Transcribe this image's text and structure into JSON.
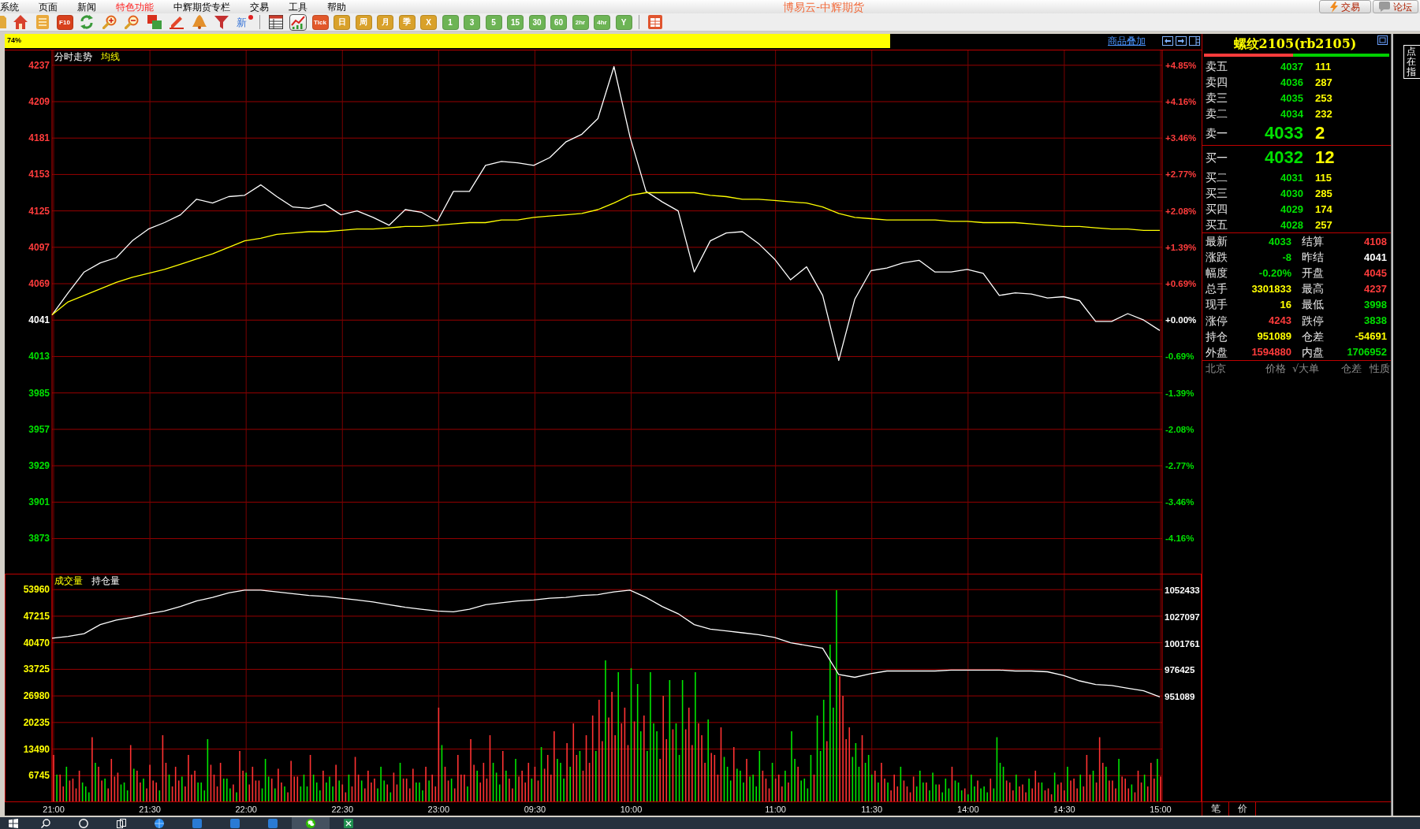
{
  "menu_bar": {
    "items": [
      {
        "label": "系统",
        "highlighted": false
      },
      {
        "label": "页面",
        "highlighted": false
      },
      {
        "label": "新闻",
        "highlighted": false
      },
      {
        "label": "特色功能",
        "highlighted": true
      },
      {
        "label": "中辉期货专栏",
        "highlighted": false
      },
      {
        "label": "交易",
        "highlighted": false
      },
      {
        "label": "工具",
        "highlighted": false
      },
      {
        "label": "帮助",
        "highlighted": false
      }
    ],
    "title": "博易云-中辉期货",
    "buttons": [
      {
        "label": "交易"
      },
      {
        "label": "论坛"
      }
    ]
  },
  "toolbar": {
    "items": [
      {
        "kind": "icon",
        "selected": false
      },
      {
        "kind": "icon",
        "selected": false
      },
      {
        "kind": "icon",
        "selected": false
      },
      {
        "kind": "text",
        "label": "F10",
        "color": "#d8401c",
        "selected": false
      },
      {
        "kind": "icon",
        "selected": false
      },
      {
        "kind": "icon",
        "selected": false
      },
      {
        "kind": "icon",
        "selected": false
      },
      {
        "kind": "icon",
        "selected": false
      },
      {
        "kind": "icon",
        "selected": false
      },
      {
        "kind": "icon",
        "selected": false
      },
      {
        "kind": "icon",
        "selected": false
      },
      {
        "kind": "dotted",
        "label": "新",
        "selected": false
      },
      {
        "kind": "separator"
      },
      {
        "kind": "icon",
        "selected": false
      },
      {
        "kind": "icon",
        "selected": true
      },
      {
        "kind": "text",
        "label": "Tick",
        "color": "#e2582a",
        "selected": false
      },
      {
        "kind": "text",
        "label": "日",
        "color": "#d9a12a",
        "selected": false
      },
      {
        "kind": "text",
        "label": "周",
        "color": "#d9a12a",
        "selected": false
      },
      {
        "kind": "text",
        "label": "月",
        "color": "#d9a12a",
        "selected": false
      },
      {
        "kind": "text",
        "label": "季",
        "color": "#d9a12a",
        "selected": false
      },
      {
        "kind": "text",
        "label": "X",
        "color": "#d9a12a",
        "selected": false
      },
      {
        "kind": "text",
        "label": "1",
        "color": "#6db455",
        "selected": false
      },
      {
        "kind": "text",
        "label": "3",
        "color": "#6db455",
        "selected": false
      },
      {
        "kind": "text",
        "label": "5",
        "color": "#6db455",
        "selected": false
      },
      {
        "kind": "text",
        "label": "15",
        "color": "#6db455",
        "selected": false
      },
      {
        "kind": "text",
        "label": "30",
        "color": "#6db455",
        "selected": false
      },
      {
        "kind": "text",
        "label": "60",
        "color": "#6db455",
        "selected": false
      },
      {
        "kind": "text",
        "label": "2hr",
        "color": "#6db455",
        "selected": false
      },
      {
        "kind": "text",
        "label": "4hr",
        "color": "#6db455",
        "selected": false
      },
      {
        "kind": "text",
        "label": "Y",
        "color": "#6db455",
        "selected": false
      },
      {
        "kind": "separator"
      },
      {
        "kind": "icon",
        "selected": false
      }
    ]
  },
  "progress_bar": {
    "label": "74%",
    "level": 0.74,
    "link": "商品叠加"
  },
  "price_panel": {
    "chart_data": {
      "type": "line",
      "grid": true,
      "categories": [
        null,
        null,
        null,
        null,
        null,
        null,
        null,
        null,
        null,
        null,
        null,
        null,
        null,
        null,
        null,
        null,
        null,
        null,
        null,
        null,
        null,
        null,
        null,
        null,
        null,
        null,
        null,
        null,
        null,
        null,
        null,
        null,
        null,
        null,
        null,
        null,
        null,
        null,
        null,
        null,
        null,
        null,
        null,
        null,
        null,
        null,
        null,
        null,
        null,
        null,
        null,
        null,
        null,
        null,
        null,
        null,
        null,
        null,
        null,
        null,
        null,
        null,
        null,
        null,
        null,
        null,
        null,
        null,
        null,
        null
      ],
      "ylim": [
        3846,
        4249
      ],
      "yticks": [
        4237,
        4209,
        4181,
        4153,
        4125,
        4097,
        4069,
        4041,
        4013,
        3985,
        3957,
        3929,
        3901,
        3873
      ],
      "series": [
        {
          "name": "分时走势",
          "color": "#ffffff",
          "values": [
            4045,
            4062,
            4078,
            4085,
            4089,
            4102,
            4111,
            4116,
            4122,
            4134,
            4131,
            4136,
            4137,
            4145,
            4136,
            4128,
            4127,
            4130,
            4122,
            4125,
            4120,
            4114,
            4126,
            4124,
            4117,
            4140,
            4140,
            4160,
            4163,
            4162,
            4160,
            4166,
            4178,
            4184,
            4196,
            4236,
            4182,
            4140,
            4132,
            4125,
            4078,
            4102,
            4108,
            4109,
            4100,
            4088,
            4072,
            4082,
            4060,
            4010,
            4057,
            4079,
            4081,
            4085,
            4087,
            4078,
            4078,
            4080,
            4077,
            4060,
            4062,
            4061,
            4058,
            4059,
            4056,
            4040,
            4040,
            4046,
            4041,
            4033
          ]
        },
        {
          "name": "均线",
          "color": "#ffff00",
          "values": [
            4045,
            4055,
            4060,
            4065,
            4070,
            4074,
            4077,
            4080,
            4084,
            4088,
            4092,
            4097,
            4102,
            4104,
            4107,
            4108,
            4109,
            4109,
            4110,
            4111,
            4111,
            4112,
            4113,
            4113,
            4114,
            4115,
            4116,
            4116,
            4118,
            4118,
            4120,
            4121,
            4122,
            4123,
            4126,
            4131,
            4137,
            4139,
            4139,
            4139,
            4139,
            4137,
            4136,
            4134,
            4134,
            4133,
            4132,
            4131,
            4128,
            4123,
            4120,
            4119,
            4118,
            4118,
            4118,
            4118,
            4117,
            4117,
            4116,
            4116,
            4116,
            4115,
            4114,
            4113,
            4113,
            4112,
            4111,
            4111,
            4110,
            4110
          ]
        }
      ]
    },
    "percent_labels": [
      {
        "label": "+4.85%",
        "kind": "up"
      },
      {
        "label": "+4.16%",
        "kind": "up"
      },
      {
        "label": "+3.46%",
        "kind": "up"
      },
      {
        "label": "+2.77%",
        "kind": "up"
      },
      {
        "label": "+2.08%",
        "kind": "up"
      },
      {
        "label": "+1.39%",
        "kind": "up"
      },
      {
        "label": "+0.69%",
        "kind": "up"
      },
      {
        "label": "+0.00%",
        "kind": "flat"
      },
      {
        "label": "-0.69%",
        "kind": "down"
      },
      {
        "label": "-1.39%",
        "kind": "down"
      },
      {
        "label": "-2.08%",
        "kind": "down"
      },
      {
        "label": "-2.77%",
        "kind": "down"
      },
      {
        "label": "-3.46%",
        "kind": "down"
      },
      {
        "label": "-4.16%",
        "kind": "down"
      }
    ]
  },
  "volume_panel": {
    "chart_data": {
      "type": "bar",
      "title": "成交量",
      "grid": true,
      "categories": [
        "21:00",
        null,
        null,
        null,
        null,
        null,
        null,
        null,
        null,
        null,
        null,
        null,
        null,
        null,
        null,
        null,
        null,
        null,
        null,
        null,
        null,
        null,
        null,
        null,
        null,
        null,
        null,
        null,
        null,
        null,
        "21:30",
        null,
        null,
        null,
        null,
        null,
        null,
        null,
        null,
        null,
        null,
        null,
        null,
        null,
        null,
        null,
        null,
        null,
        null,
        null,
        null,
        null,
        null,
        null,
        null,
        null,
        null,
        null,
        null,
        null,
        "22:00",
        null,
        null,
        null,
        null,
        null,
        null,
        null,
        null,
        null,
        null,
        null,
        null,
        null,
        null,
        null,
        null,
        null,
        null,
        null,
        null,
        null,
        null,
        null,
        null,
        null,
        null,
        null,
        null,
        null,
        "22:30",
        null,
        null,
        null,
        null,
        null,
        null,
        null,
        null,
        null,
        null,
        null,
        null,
        null,
        null,
        null,
        null,
        null,
        null,
        null,
        null,
        null,
        null,
        null,
        null,
        null,
        null,
        null,
        null,
        null,
        "23:00",
        null,
        null,
        null,
        null,
        null,
        null,
        null,
        null,
        null,
        null,
        null,
        null,
        null,
        null,
        null,
        null,
        null,
        null,
        null,
        null,
        null,
        null,
        null,
        null,
        null,
        null,
        null,
        null,
        null,
        "09:30",
        null,
        null,
        null,
        null,
        null,
        null,
        null,
        null,
        null,
        null,
        null,
        null,
        null,
        null,
        null,
        null,
        null,
        null,
        null,
        null,
        null,
        null,
        null,
        null,
        null,
        null,
        null,
        null,
        null,
        "10:00",
        null,
        null,
        null,
        null,
        null,
        null,
        null,
        null,
        null,
        null,
        null,
        null,
        null,
        null,
        null,
        null,
        null,
        null,
        null,
        null,
        null,
        null,
        null,
        null,
        null,
        null,
        null,
        null,
        null,
        null,
        null,
        null,
        null,
        null,
        null,
        null,
        null,
        null,
        null,
        null,
        null,
        null,
        null,
        null,
        "11:00",
        null,
        null,
        null,
        null,
        null,
        null,
        null,
        null,
        null,
        null,
        null,
        null,
        null,
        null,
        null,
        null,
        null,
        null,
        null,
        null,
        null,
        null,
        null,
        null,
        null,
        null,
        null,
        null,
        null,
        "11:30",
        null,
        null,
        null,
        null,
        null,
        null,
        null,
        null,
        null,
        null,
        null,
        null,
        null,
        null,
        null,
        null,
        null,
        null,
        null,
        null,
        null,
        null,
        null,
        null,
        null,
        null,
        null,
        null,
        null,
        "14:00",
        null,
        null,
        null,
        null,
        null,
        null,
        null,
        null,
        null,
        null,
        null,
        null,
        null,
        null,
        null,
        null,
        null,
        null,
        null,
        null,
        null,
        null,
        null,
        null,
        null,
        null,
        null,
        null,
        null,
        "14:30",
        null,
        null,
        null,
        null,
        null,
        null,
        null,
        null,
        null,
        null,
        null,
        null,
        null,
        null,
        null,
        null,
        null,
        null,
        null,
        null,
        null,
        null,
        null,
        null,
        null,
        null,
        null,
        null,
        null,
        "15:00"
      ],
      "ylim": [
        0,
        58000
      ],
      "yticks": [
        53960,
        47215,
        40470,
        33725,
        26980,
        20235,
        13490,
        6745
      ],
      "series": [
        {
          "color": "#ff3232",
          "values": [
            12000,
            null,
            7000,
            4000,
            null,
            5500,
            6000,
            3500,
            8000,
            null,
            null,
            null,
            16500,
            null,
            9000,
            5500,
            null,
            3500,
            11000,
            6500,
            7500,
            null,
            null,
            null,
            14500,
            null,
            8000,
            5000,
            null,
            3500,
            9500,
            5500,
            5000,
            null,
            17000,
            10000,
            null,
            4000,
            9000,
            5500,
            null,
            4000,
            12000,
            7000,
            8000,
            null,
            null,
            null,
            null,
            9500,
            7000,
            4000,
            10000,
            null,
            null,
            null,
            4500,
            null,
            13000,
            8000,
            null,
            4500,
            9000,
            5500,
            5500,
            null,
            null,
            null,
            6000,
            null,
            8500,
            5000,
            null,
            2500,
            10500,
            6500,
            6500,
            null,
            null,
            null,
            12000,
            null,
            null,
            null,
            8000,
            null,
            null,
            null,
            9500,
            null,
            4500,
            2500,
            null,
            4000,
            11500,
            7000,
            null,
            3500,
            8000,
            5000,
            6000,
            null,
            null,
            null,
            4500,
            null,
            7500,
            4500,
            null,
            6000,
            6000,
            3500,
            8500,
            null,
            null,
            null,
            9000,
            null,
            7000,
            4000,
            24000,
            null,
            9000,
            5500,
            null,
            3500,
            12000,
            7000,
            7000,
            null,
            16000,
            9500,
            null,
            5000,
            10000,
            6000,
            17000,
            null,
            null,
            null,
            13000,
            null,
            6000,
            3500,
            null,
            6500,
            8000,
            5000,
            10000,
            null,
            9000,
            5500,
            null,
            8500,
            12000,
            7000,
            18000,
            null,
            null,
            null,
            15000,
            null,
            20000,
            12000,
            null,
            8000,
            17000,
            10000,
            22000,
            null,
            26000,
            15500,
            null,
            21500,
            28000,
            17000,
            null,
            20000,
            24000,
            14500,
            null,
            20500,
            null,
            null,
            22000,
            null,
            null,
            null,
            null,
            11000,
            27000,
            16000,
            null,
            18500,
            null,
            null,
            null,
            18500,
            24000,
            14500,
            null,
            20000,
            17000,
            10000,
            null,
            12500,
            12000,
            7000,
            19000,
            null,
            null,
            null,
            14000,
            null,
            null,
            null,
            11000,
            null,
            null,
            null,
            null,
            8000,
            6000,
            3500,
            null,
            6000,
            7000,
            4000,
            null,
            5000,
            null,
            null,
            9000,
            null,
            null,
            null,
            null,
            7000,
            null,
            null,
            null,
            15500,
            null,
            null,
            null,
            32000,
            27000,
            16000,
            19000,
            null,
            null,
            null,
            17000,
            null,
            null,
            null,
            8000,
            null,
            10000,
            6000,
            null,
            3000,
            7000,
            4000,
            null,
            5500,
            4000,
            2500,
            6500,
            null,
            null,
            null,
            5000,
            null,
            null,
            null,
            4500,
            null,
            null,
            null,
            9000,
            null,
            null,
            null,
            3500,
            null,
            null,
            null,
            5500,
            null,
            null,
            null,
            6000,
            null,
            null,
            null,
            null,
            5500,
            5000,
            3000,
            null,
            4000,
            4500,
            2500,
            null,
            3500,
            8000,
            5000,
            null,
            3000,
            3500,
            2000,
            null,
            4500,
            5000,
            3000,
            null,
            5500,
            6000,
            3500,
            null,
            4000,
            12000,
            7000,
            null,
            5000,
            16500,
            10000,
            null,
            5500,
            5500,
            3500,
            null,
            6500,
            6000,
            3500,
            null,
            2500,
            8000,
            5000,
            null,
            4000,
            10000,
            6000,
            null,
            6500
          ]
        },
        {
          "color": "#00e600",
          "values": [
            null,
            7000,
            null,
            null,
            9000,
            null,
            null,
            null,
            null,
            5000,
            4000,
            2500,
            null,
            10000,
            null,
            null,
            6000,
            null,
            null,
            null,
            null,
            4500,
            5000,
            3000,
            null,
            8500,
            null,
            null,
            6000,
            null,
            null,
            null,
            null,
            3000,
            null,
            null,
            7000,
            null,
            null,
            null,
            6500,
            null,
            null,
            null,
            null,
            5000,
            5000,
            3000,
            16000,
            null,
            null,
            null,
            null,
            6000,
            6000,
            3500,
            null,
            2500,
            null,
            null,
            7500,
            null,
            null,
            null,
            null,
            3500,
            11000,
            6500,
            null,
            3500,
            null,
            null,
            4000,
            null,
            null,
            null,
            null,
            4000,
            7000,
            4000,
            null,
            7000,
            5000,
            3000,
            null,
            5000,
            6500,
            4000,
            null,
            5500,
            null,
            null,
            7000,
            null,
            null,
            null,
            5500,
            null,
            null,
            null,
            null,
            3500,
            9000,
            5500,
            null,
            2500,
            null,
            null,
            10000,
            null,
            null,
            null,
            null,
            5000,
            5000,
            3000,
            null,
            5500,
            null,
            null,
            null,
            14500,
            null,
            null,
            6000,
            null,
            null,
            null,
            null,
            4000,
            null,
            null,
            8000,
            null,
            null,
            null,
            null,
            10000,
            7500,
            4500,
            null,
            8000,
            null,
            null,
            11000,
            null,
            null,
            null,
            null,
            6000,
            null,
            null,
            14000,
            null,
            null,
            null,
            null,
            11000,
            10000,
            6000,
            null,
            9000,
            null,
            null,
            13000,
            null,
            null,
            null,
            null,
            13000,
            null,
            null,
            36000,
            null,
            null,
            null,
            33000,
            null,
            null,
            null,
            34000,
            null,
            30000,
            18000,
            null,
            13000,
            33000,
            20000,
            18000,
            null,
            null,
            null,
            31000,
            null,
            20000,
            12000,
            31000,
            null,
            null,
            null,
            33000,
            null,
            null,
            null,
            21000,
            null,
            null,
            null,
            null,
            11500,
            9000,
            5500,
            null,
            8500,
            8000,
            5000,
            null,
            6500,
            7000,
            4000,
            13000,
            null,
            null,
            null,
            10000,
            null,
            null,
            null,
            8000,
            null,
            18000,
            11000,
            null,
            5500,
            6000,
            3500,
            12000,
            null,
            22000,
            13000,
            26000,
            null,
            40000,
            24000,
            53800,
            null,
            null,
            null,
            null,
            11500,
            15000,
            9000,
            null,
            10000,
            12000,
            7000,
            null,
            5000,
            null,
            null,
            5000,
            null,
            null,
            null,
            9000,
            null,
            null,
            null,
            null,
            4000,
            8000,
            5000,
            null,
            3000,
            7500,
            4500,
            null,
            2500,
            6000,
            3500,
            null,
            5500,
            5000,
            3000,
            null,
            2000,
            7000,
            4000,
            null,
            3500,
            4000,
            2500,
            null,
            3500,
            16500,
            10000,
            9000,
            null,
            null,
            null,
            7000,
            null,
            null,
            null,
            6000,
            null,
            null,
            null,
            5000,
            null,
            null,
            null,
            7500,
            null,
            null,
            null,
            9000,
            null,
            null,
            null,
            7000,
            null,
            null,
            null,
            8000,
            null,
            null,
            null,
            9000,
            null,
            null,
            null,
            11000,
            null,
            null,
            null,
            4500,
            null,
            null,
            null,
            7000,
            null,
            null,
            null,
            11000,
            null
          ]
        }
      ]
    },
    "open_interest": {
      "chart_data": {
        "type": "line",
        "categories": [
          null,
          null,
          null,
          null,
          null,
          null,
          null,
          null,
          null,
          null,
          null,
          null,
          null,
          null,
          null,
          null,
          null,
          null,
          null,
          null,
          null,
          null,
          null,
          null,
          null,
          null,
          null,
          null,
          null,
          null,
          null,
          null,
          null,
          null,
          null,
          null,
          null,
          null,
          null,
          null,
          null,
          null,
          null,
          null,
          null,
          null,
          null,
          null,
          null,
          null,
          null,
          null,
          null,
          null,
          null,
          null,
          null,
          null,
          null,
          null,
          null,
          null,
          null,
          null,
          null,
          null,
          null,
          null,
          null,
          null
        ],
        "ylim": [
          851200,
          1068000
        ],
        "yticks": [
          1052433,
          1027097,
          1001761,
          976425,
          951089
        ],
        "series": [
          {
            "name": "持仓量",
            "color": "#ffffff",
            "values": [
              1006800,
              1008500,
              1011100,
              1019700,
              1024000,
              1026600,
              1030000,
              1032600,
              1036900,
              1042100,
              1045500,
              1049800,
              1052400,
              1052400,
              1050700,
              1049000,
              1047300,
              1046400,
              1044700,
              1043000,
              1041200,
              1038600,
              1036100,
              1034300,
              1032600,
              1031800,
              1034300,
              1038600,
              1040400,
              1042100,
              1043000,
              1044700,
              1045500,
              1047300,
              1048100,
              1050700,
              1052400,
              1045500,
              1036900,
              1030000,
              1019700,
              1015400,
              1013700,
              1011900,
              1010200,
              1007600,
              1002400,
              999900,
              997300,
              972300,
              969700,
              973100,
              975700,
              975700,
              975700,
              975700,
              976600,
              976600,
              976600,
              976600,
              975700,
              975700,
              974900,
              971400,
              966300,
              962800,
              961900,
              959400,
              956800,
              951100
            ]
          }
        ]
      }
    }
  },
  "quote_panel": {
    "title": "螺纹2105(rb2105)",
    "buy_ratio": {
      "level": 0.48
    },
    "asks": [
      {
        "label": "卖五",
        "price": "4037",
        "volume": "111",
        "kind": "down",
        "best": false
      },
      {
        "label": "卖四",
        "price": "4036",
        "volume": "287",
        "kind": "down",
        "best": false
      },
      {
        "label": "卖三",
        "price": "4035",
        "volume": "253",
        "kind": "down",
        "best": false
      },
      {
        "label": "卖二",
        "price": "4034",
        "volume": "232",
        "kind": "down",
        "best": false
      },
      {
        "label": "卖一",
        "price": "4033",
        "volume": "2",
        "kind": "down",
        "best": true
      }
    ],
    "bids": [
      {
        "label": "买一",
        "price": "4032",
        "volume": "12",
        "kind": "down",
        "best": true
      },
      {
        "label": "买二",
        "price": "4031",
        "volume": "115",
        "kind": "down",
        "best": false
      },
      {
        "label": "买三",
        "price": "4030",
        "volume": "285",
        "kind": "down",
        "best": false
      },
      {
        "label": "买四",
        "price": "4029",
        "volume": "174",
        "kind": "down",
        "best": false
      },
      {
        "label": "买五",
        "price": "4028",
        "volume": "257",
        "kind": "down",
        "best": false
      }
    ],
    "stats": [
      {
        "label": "最新",
        "value": "4033",
        "kind": "down"
      },
      {
        "label": "结算",
        "value": "4108",
        "kind": "up"
      },
      {
        "label": "涨跌",
        "value": "-8",
        "kind": "down"
      },
      {
        "label": "昨结",
        "value": "4041",
        "kind": "flat"
      },
      {
        "label": "幅度",
        "value": "-0.20%",
        "kind": "down"
      },
      {
        "label": "开盘",
        "value": "4045",
        "kind": "up"
      },
      {
        "label": "总手",
        "value": "3301833",
        "kind": "count"
      },
      {
        "label": "最高",
        "value": "4237",
        "kind": "up"
      },
      {
        "label": "现手",
        "value": "16",
        "kind": "count"
      },
      {
        "label": "最低",
        "value": "3998",
        "kind": "down"
      },
      {
        "label": "涨停",
        "value": "4243",
        "kind": "up"
      },
      {
        "label": "跌停",
        "value": "3838",
        "kind": "down"
      },
      {
        "label": "持仓",
        "value": "951089",
        "kind": "count"
      },
      {
        "label": "仓差",
        "value": "-54691",
        "kind": "count"
      },
      {
        "label": "外盘",
        "value": "1594880",
        "kind": "up"
      },
      {
        "label": "内盘",
        "value": "1706952",
        "kind": "down"
      }
    ],
    "trade_header": [
      "北京",
      "价格",
      "√大单",
      "仓差",
      "性质"
    ],
    "tabs": [
      "笔",
      "价"
    ]
  },
  "side_note": {
    "lines": [
      "点",
      "在",
      "指"
    ]
  },
  "taskbar": {
    "apps": [
      {
        "selected": false
      },
      {
        "selected": false
      },
      {
        "selected": false
      },
      {
        "selected": false
      },
      {
        "selected": false
      },
      {
        "selected": false
      },
      {
        "selected": false
      },
      {
        "selected": false
      },
      {
        "selected": true
      },
      {
        "selected": false
      }
    ]
  }
}
